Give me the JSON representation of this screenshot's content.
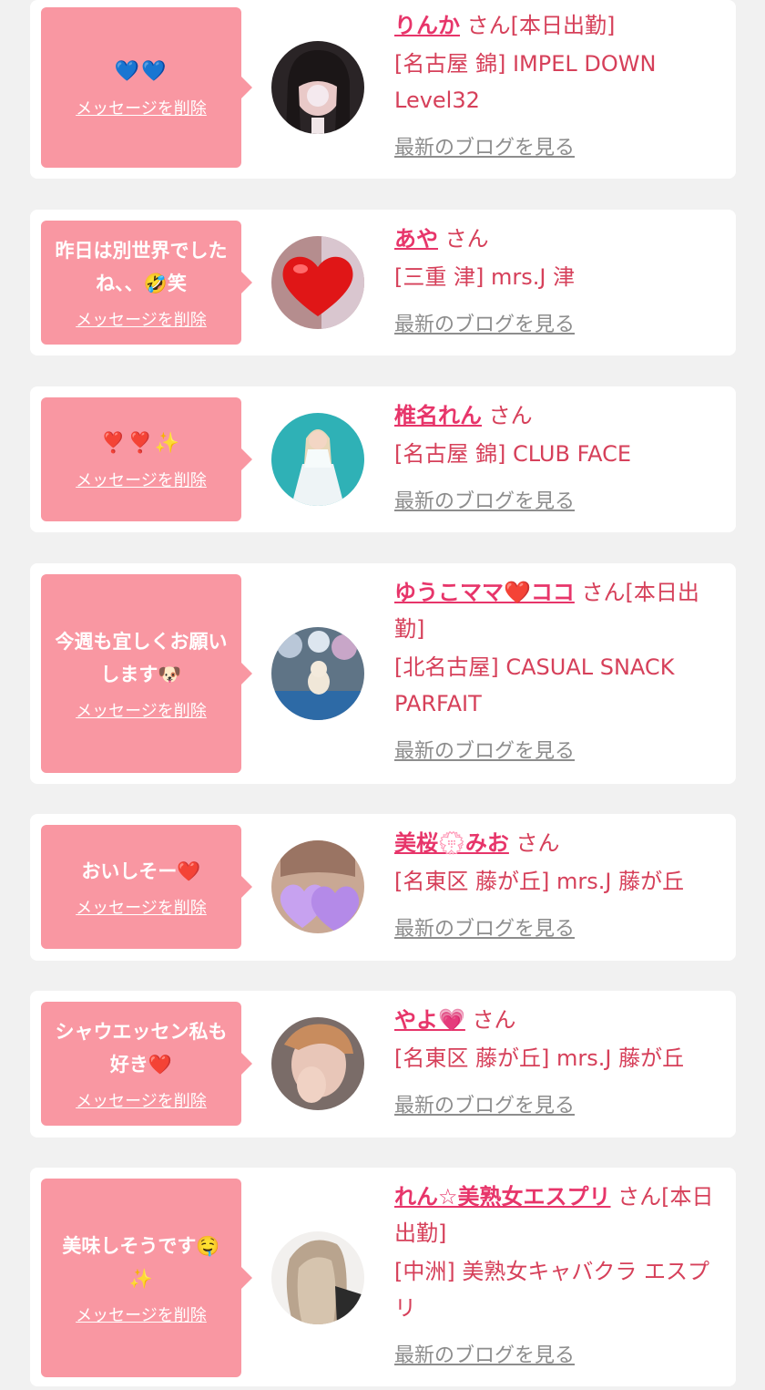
{
  "colors": {
    "background": "#f1f1f1",
    "card": "#ffffff",
    "bubble": "#f997a2",
    "name": "#e7356a",
    "text": "#d6405a",
    "link": "#8d8d8d"
  },
  "cards": [
    {
      "message": "💙💙",
      "delete_label": "メッセージを削除",
      "name": "りんか",
      "suffix": "さん[本日出勤]",
      "shop": "[名古屋 錦] IMPEL DOWN Level32",
      "blog_label": "最新のブログを見る",
      "avatar_icon": "portrait-girl-dark-hair"
    },
    {
      "message": "昨日は別世界でしたね、、🤣笑",
      "delete_label": "メッセージを削除",
      "name": "あや",
      "suffix": "さん",
      "shop": "[三重 津] mrs.J 津",
      "blog_label": "最新のブログを見る",
      "avatar_icon": "red-heart-photo"
    },
    {
      "message": "❣️❣️✨",
      "delete_label": "メッセージを削除",
      "name": "椎名れん",
      "suffix": "さん",
      "shop": "[名古屋 錦] CLUB FACE",
      "blog_label": "最新のブログを見る",
      "avatar_icon": "portrait-teal-dress"
    },
    {
      "message": "今週も宜しくお願いします🐶",
      "delete_label": "メッセージを削除",
      "name": "ゆうこママ❤️ココ",
      "suffix": "さん[本日出勤]",
      "shop": "[北名古屋] CASUAL SNACK PARFAIT",
      "blog_label": "最新のブログを見る",
      "avatar_icon": "photo-dog-flowers"
    },
    {
      "message": "おいしそー❤️",
      "delete_label": "メッセージを削除",
      "name": "美桜💮みお",
      "suffix": "さん",
      "shop": "[名東区 藤が丘] mrs.J 藤が丘",
      "blog_label": "最新のブログを見る",
      "avatar_icon": "portrait-purple-hearts"
    },
    {
      "message": "シャウエッセン私も好き❤️",
      "delete_label": "メッセージを削除",
      "name": "やよ💗",
      "suffix": "さん",
      "shop": "[名東区 藤が丘] mrs.J 藤が丘",
      "blog_label": "最新のブログを見る",
      "avatar_icon": "portrait-hand-face"
    },
    {
      "message": "美味しそうです🤤✨",
      "delete_label": "メッセージを削除",
      "name": "れん☆美熟女エスプリ",
      "suffix": "さん[本日出勤]",
      "shop": "[中洲] 美熟女キャバクラ エスプリ",
      "blog_label": "最新のブログを見る",
      "avatar_icon": "portrait-blonde-hair"
    }
  ]
}
